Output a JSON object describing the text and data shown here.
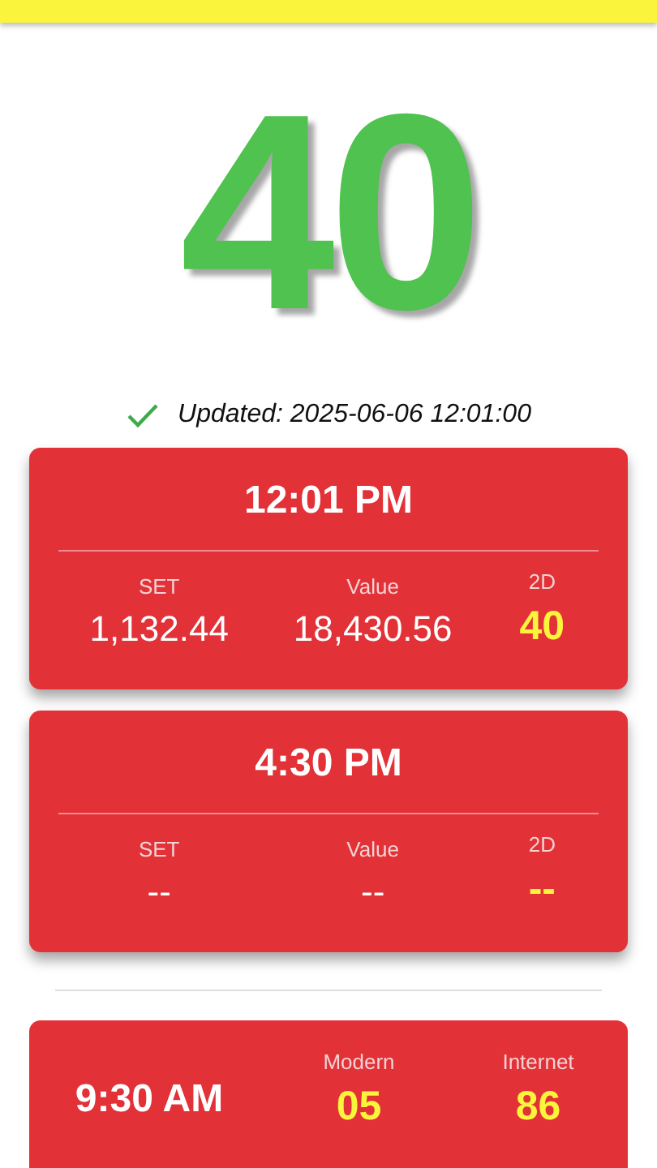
{
  "result": "40",
  "updated": "Updated: 2025-06-06 12:01:00",
  "sessions": [
    {
      "time": "12:01 PM",
      "set_label": "SET",
      "set": "1,132.44",
      "value_label": "Value",
      "value": "18,430.56",
      "twod_label": "2D",
      "twod": "40"
    },
    {
      "time": "4:30 PM",
      "set_label": "SET",
      "set": "--",
      "value_label": "Value",
      "value": "--",
      "twod_label": "2D",
      "twod": "--"
    }
  ],
  "modern_internet": [
    {
      "time": "9:30 AM",
      "modern_label": "Modern",
      "modern": "05",
      "internet_label": "Internet",
      "internet": "86"
    }
  ]
}
